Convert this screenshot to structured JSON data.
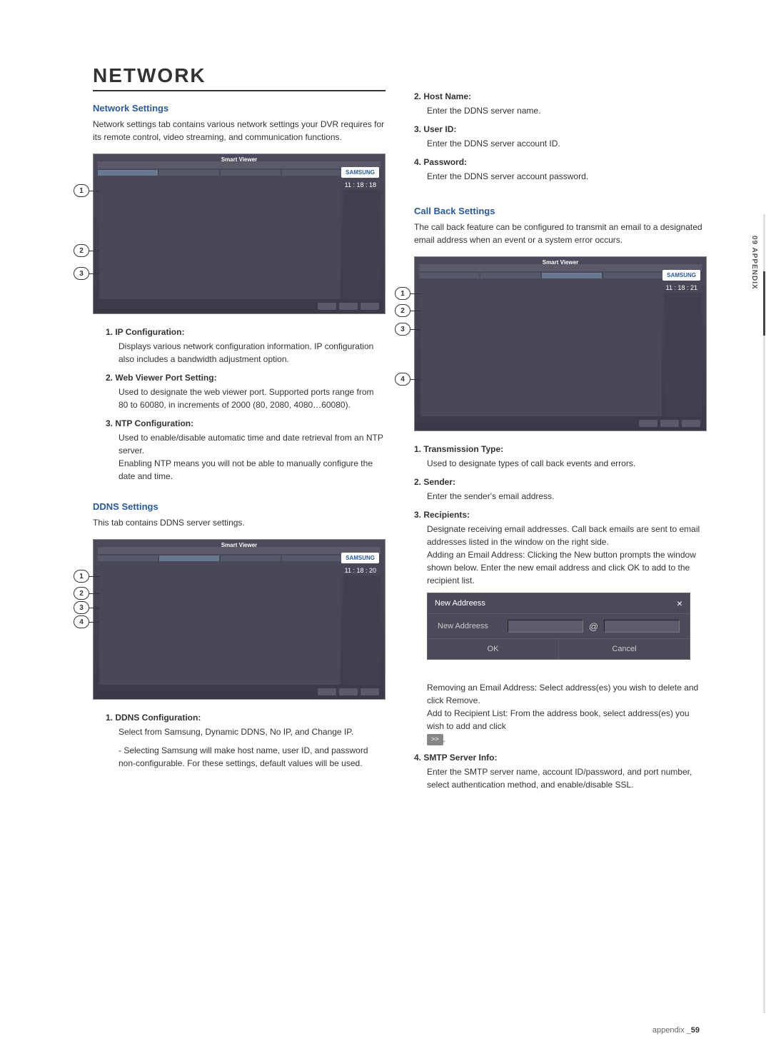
{
  "sideTab": "09 APPENDIX",
  "footer": {
    "label": "appendix _",
    "page": "59"
  },
  "left": {
    "title": "NETWORK",
    "networkSettings": {
      "header": "Network Settings",
      "desc": "Network settings tab contains various network settings your DVR requires for its remote control, video streaming, and communication functions.",
      "screenshotTitle": "Smart Viewer",
      "brand": "SAMSUNG",
      "time": "11 : 18 : 18",
      "callouts": [
        "1",
        "2",
        "3"
      ],
      "items": [
        {
          "title": "1. IP Configuration:",
          "body": "Displays various network configuration information. IP configuration also includes a bandwidth adjustment option."
        },
        {
          "title": "2. Web Viewer Port Setting:",
          "body": "Used to designate the web viewer port. Supported ports range from 80 to 60080, in increments of 2000 (80, 2080, 4080…60080)."
        },
        {
          "title": "3. NTP Configuration:",
          "body": "Used to enable/disable automatic time and date retrieval from an NTP server.\nEnabling NTP means you will not be able to manually configure the date and time."
        }
      ]
    },
    "ddnsSettings": {
      "header": "DDNS Settings",
      "desc": "This tab contains DDNS server settings.",
      "screenshotTitle": "Smart Viewer",
      "brand": "SAMSUNG",
      "time": "11 : 18 : 20",
      "callouts": [
        "1",
        "2",
        "3",
        "4"
      ],
      "items": [
        {
          "title": "1. DDNS Configuration:",
          "body": "Select from Samsung, Dynamic DDNS, No IP, and Change IP.",
          "dash": "- Selecting Samsung will make host name, user ID, and password non-configurable. For these settings, default values will be used."
        }
      ]
    }
  },
  "right": {
    "topItems": [
      {
        "title": "2. Host Name:",
        "body": "Enter the DDNS server name."
      },
      {
        "title": "3. User ID:",
        "body": "Enter the DDNS server account ID."
      },
      {
        "title": "4. Password:",
        "body": "Enter the DDNS server account password."
      }
    ],
    "callBack": {
      "header": "Call Back Settings",
      "desc": "The call back feature can be configured to transmit an email to a designated email address when an event or a system error occurs.",
      "screenshotTitle": "Smart Viewer",
      "brand": "SAMSUNG",
      "time": "11 : 18 : 21",
      "callouts": [
        "1",
        "2",
        "3",
        "4"
      ],
      "items": [
        {
          "title": "1. Transmission Type:",
          "body": "Used to designate types of call back events and errors."
        },
        {
          "title": "2. Sender:",
          "body": "Enter the sender's email address."
        },
        {
          "title": "3. Recipients:",
          "body": "Designate receiving email addresses. Call back emails are sent to email addresses listed in the window on the right side.\nAdding an Email Address: Clicking the New button prompts the window shown below. Enter the new email address and click OK to add to the recipient list."
        },
        {
          "title": "4. SMTP Server Info:",
          "body": "Enter the SMTP server name, account ID/password, and port number, select authentication method, and enable/disable SSL."
        }
      ],
      "afterDialog": "Removing an Email Address: Select address(es) you wish to delete and click Remove.\nAdd to Recipient List: From the address book, select address(es) you wish to add and click",
      "arrowBtn": ">>",
      "period": "."
    },
    "dialog": {
      "title": "New Addreess",
      "label": "New Addreess",
      "ok": "OK",
      "cancel": "Cancel"
    }
  }
}
